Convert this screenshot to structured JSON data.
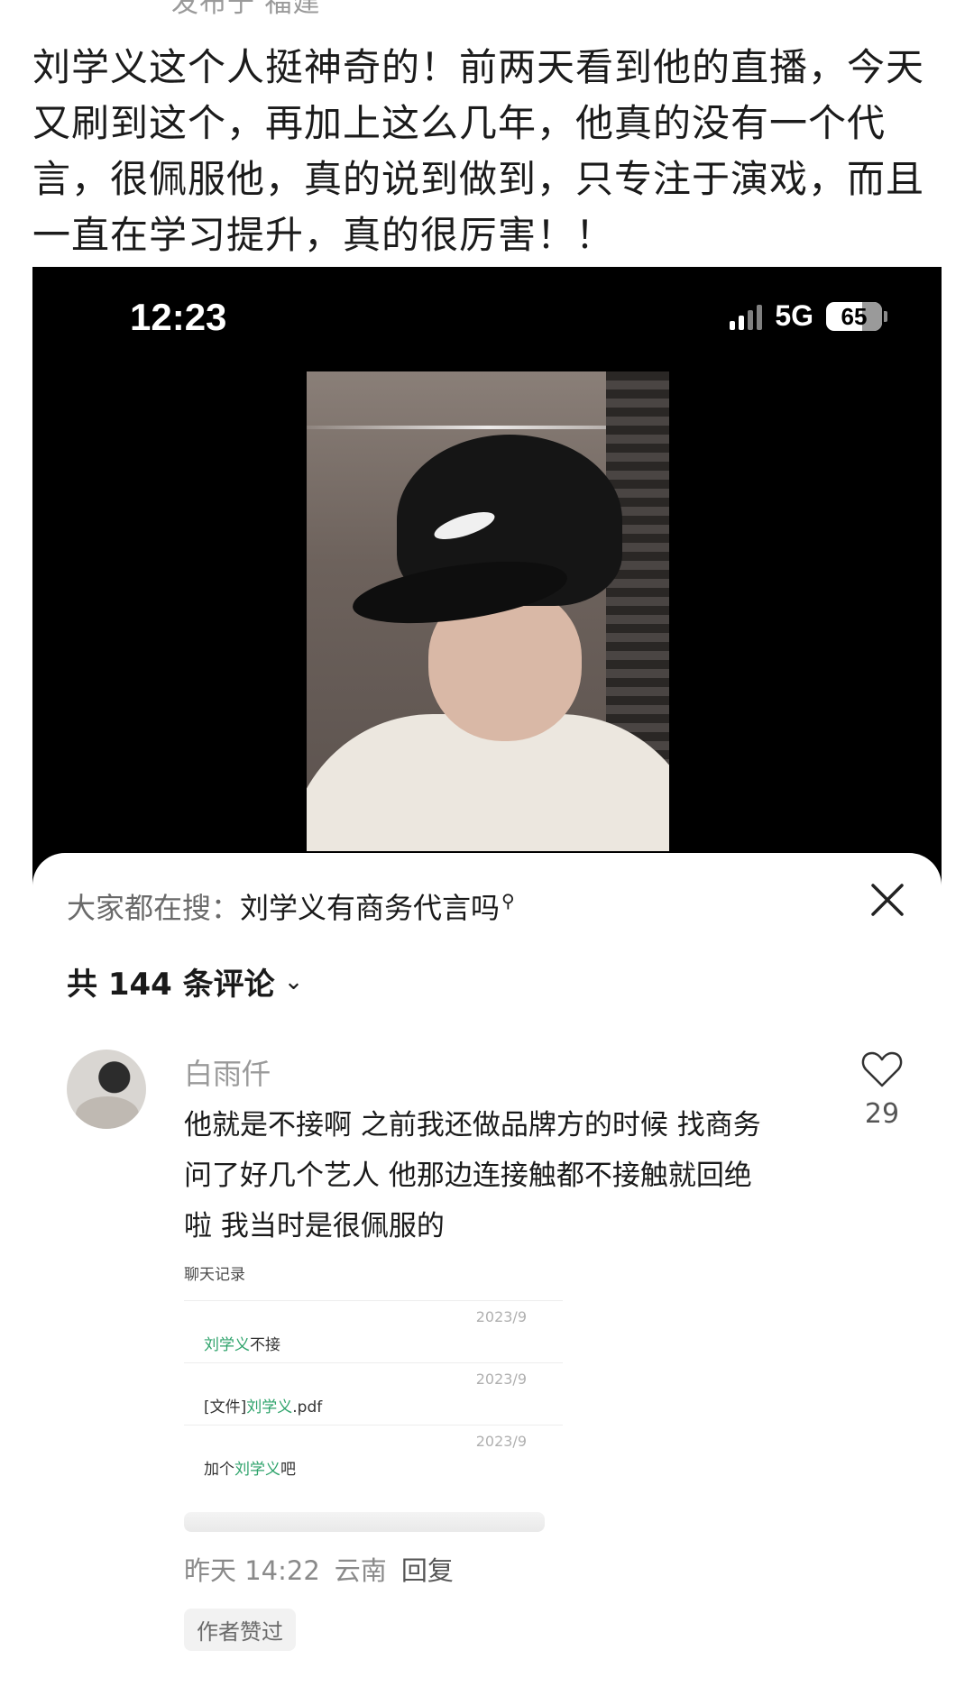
{
  "top_meta": "发布于 福建",
  "post_text": "刘学义这个人挺神奇的！前两天看到他的直播，今天又刷到这个，再加上这么几年，他真的没有一个代言，很佩服他，真的说到做到，只专注于演戏，而且一直在学习提升，真的很厉害！！",
  "status_bar": {
    "time": "12:23",
    "network": "5G",
    "battery": "65"
  },
  "sheet": {
    "search_prefix": "大家都在搜：",
    "search_query": "刘学义有商务代言吗",
    "comment_count_label": "共 144 条评论",
    "comment": {
      "username": "白雨仟",
      "text": "他就是不接啊  之前我还做品牌方的时候 找商务问了好几个艺人  他那边连接触都不接触就回绝啦   我当时是很佩服的",
      "likes": "29",
      "chat": {
        "title": "聊天记录",
        "rows": [
          {
            "date": "2023/9",
            "before": "",
            "highlight": "刘学义",
            "after": "不接"
          },
          {
            "date": "2023/9",
            "before": "[文件]",
            "highlight": "刘学义",
            "after": ".pdf"
          },
          {
            "date": "2023/9",
            "before": "加个",
            "highlight": "刘学义",
            "after": "吧"
          }
        ]
      },
      "time": "昨天 14:22",
      "location": "云南",
      "reply_label": "回复",
      "author_liked": "作者赞过"
    }
  }
}
